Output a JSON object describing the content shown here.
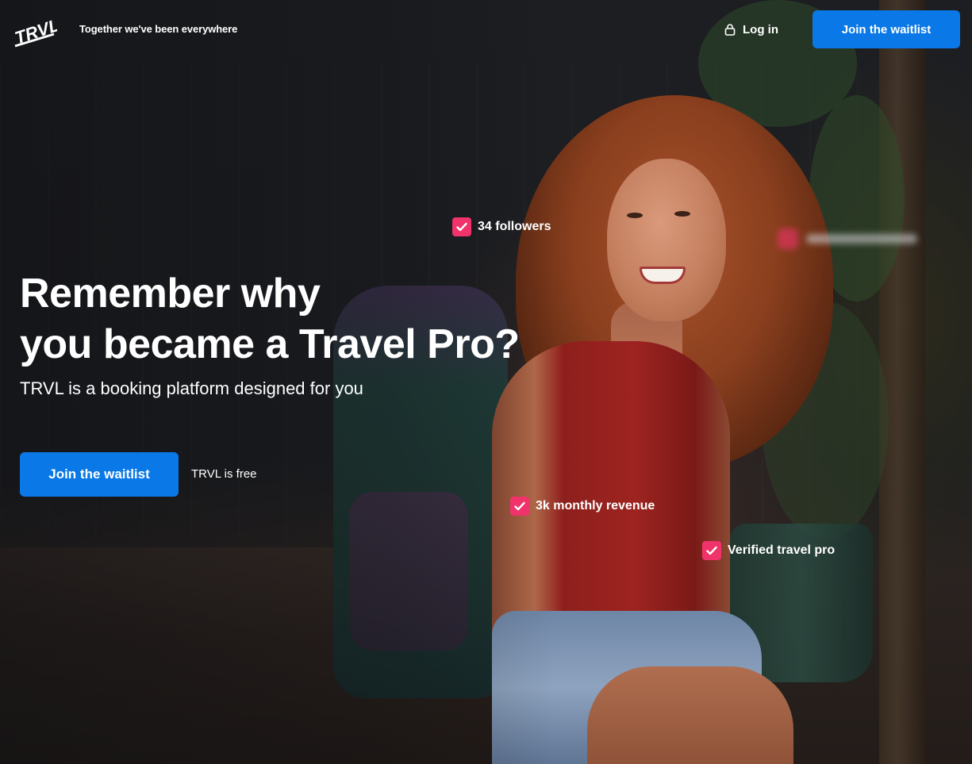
{
  "header": {
    "logo_text": "TRVL",
    "tagline": "Together we've been everywhere",
    "login_label": "Log in",
    "cta_label": "Join the waitlist"
  },
  "hero": {
    "headline_line1": "Remember why",
    "headline_line2": "you became a Travel Pro?",
    "subhead": "TRVL is a booking platform designed for you",
    "cta_label": "Join the waitlist",
    "free_note": "TRVL is free"
  },
  "badges": [
    {
      "label": "34 followers",
      "icon": "check-icon"
    },
    {
      "label": "3k monthly revenue",
      "icon": "check-icon"
    },
    {
      "label": "Verified travel pro",
      "icon": "check-icon"
    }
  ],
  "colors": {
    "primary_button": "#0a78e6",
    "badge_check": "#f0336a",
    "text": "#ffffff"
  }
}
